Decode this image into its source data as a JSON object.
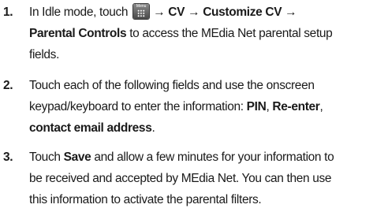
{
  "steps": [
    {
      "number": "1.",
      "pre_icon": "In Idle mode, touch",
      "menu_key_label": "Menu",
      "menu_key_icon": "menu-grid-icon",
      "path": "→ CV → Customize CV →",
      "path_cont": "Parental Controls",
      "after_path": " to access the MEdia Net parental setup",
      "line3": "fields."
    },
    {
      "number": "2.",
      "line1": "Touch each of the following fields and use the onscreen",
      "line2_pre": "keypad/keyboard to enter the information: ",
      "line2_pin": "PIN",
      "line2_sep": ", ",
      "line2_reenter": "Re-enter",
      "line2_comma": ",",
      "line3_bold": "contact email address",
      "line3_end": "."
    },
    {
      "number": "3.",
      "line1_pre": "Touch ",
      "line1_save": "Save",
      "line1_post": " and allow a few minutes for your information to",
      "line2": "be received and accepted by MEdia Net. You can then use",
      "line3": "this information to activate the parental filters."
    }
  ]
}
